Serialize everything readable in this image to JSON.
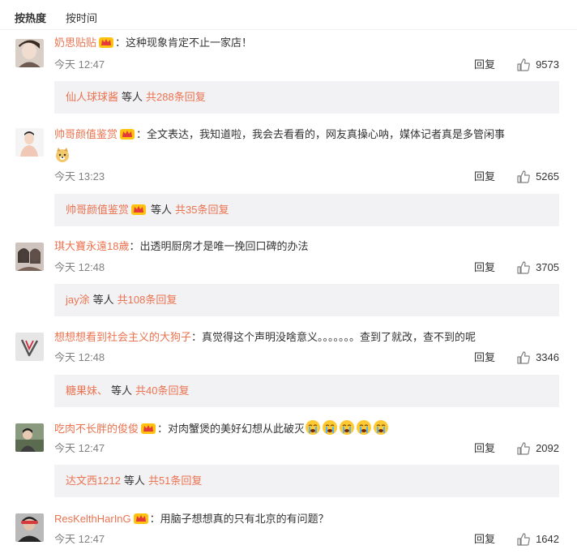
{
  "tabs": {
    "hot": "按热度",
    "time": "按时间"
  },
  "labels": {
    "reply": "回复",
    "and_others": "等人"
  },
  "colors": {
    "username": "#eb7350",
    "text": "#333333",
    "timestamp": "#808080",
    "reply_box_bg": "#f2f2f5"
  },
  "icons": {
    "like": "thumbs-up-icon",
    "member_badge": "crown-badge-icon"
  },
  "comments": [
    {
      "user": "奶思贴贴",
      "text": "：这种现象肯定不止一家店！",
      "time": "今天 12:47",
      "likes": "9573",
      "sub_name": "仙人球球酱",
      "sub_total": "共288条回复"
    },
    {
      "user": "帅哥颜值鉴赏",
      "text": "：全文表达，我知道啦，我会去看看的，网友真操心呐，媒体记者真是多管闲事",
      "time": "今天 13:23",
      "likes": "5265",
      "sub_name": "帅哥颜值鉴赏",
      "sub_total": "共35条回复"
    },
    {
      "user": "琪大寶永遠18歲",
      "text": "：出透明厨房才是唯一挽回口碑的办法",
      "time": "今天 12:48",
      "likes": "3705",
      "sub_name": "jay涂",
      "sub_total": "共108条回复"
    },
    {
      "user": "想想想看到社会主义的大狗子",
      "text": "：真觉得这个声明没啥意义。。。。。。。查到了就改，查不到的呢",
      "time": "今天 12:48",
      "likes": "3346",
      "sub_name": "糖果妹、",
      "sub_total": "共40条回复"
    },
    {
      "user": "吃肉不长胖的俊俊",
      "text": "：对肉蟹煲的美好幻想从此破灭",
      "time": "今天 12:47",
      "likes": "2092",
      "sub_name": "达文西1212",
      "sub_total": "共51条回复"
    },
    {
      "user": "ResKelthHarInG",
      "text": "：用脑子想想真的只有北京的有问题？",
      "time": "今天 12:47",
      "likes": "1642"
    }
  ]
}
